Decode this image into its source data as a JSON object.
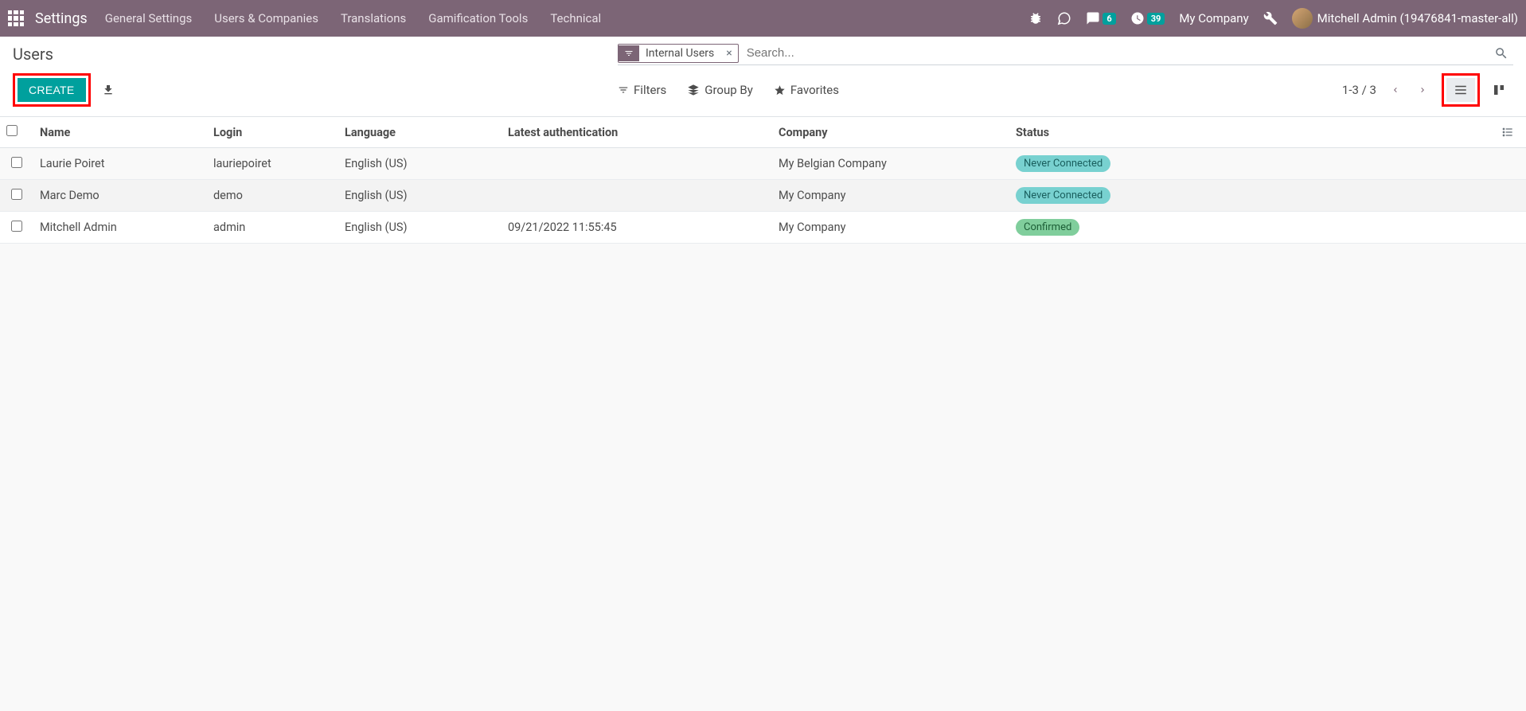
{
  "navbar": {
    "brand": "Settings",
    "menu": [
      "General Settings",
      "Users & Companies",
      "Translations",
      "Gamification Tools",
      "Technical"
    ],
    "badge_messages": "6",
    "badge_activities": "39",
    "company": "My Company",
    "user": "Mitchell Admin (19476841-master-all)"
  },
  "breadcrumb": "Users",
  "search": {
    "facet_label": "Internal Users",
    "placeholder": "Search..."
  },
  "buttons": {
    "create": "CREATE"
  },
  "tools": {
    "filters": "Filters",
    "group_by": "Group By",
    "favorites": "Favorites"
  },
  "pager": "1-3 / 3",
  "columns": {
    "name": "Name",
    "login": "Login",
    "language": "Language",
    "latest_auth": "Latest authentication",
    "company": "Company",
    "status": "Status"
  },
  "rows": [
    {
      "name": "Laurie Poiret",
      "login": "lauriepoiret",
      "language": "English (US)",
      "latest_auth": "",
      "company": "My Belgian Company",
      "status": "Never Connected",
      "status_class": "status-never"
    },
    {
      "name": "Marc Demo",
      "login": "demo",
      "language": "English (US)",
      "latest_auth": "",
      "company": "My Company",
      "status": "Never Connected",
      "status_class": "status-never"
    },
    {
      "name": "Mitchell Admin",
      "login": "admin",
      "language": "English (US)",
      "latest_auth": "09/21/2022 11:55:45",
      "company": "My Company",
      "status": "Confirmed",
      "status_class": "status-confirmed"
    }
  ]
}
